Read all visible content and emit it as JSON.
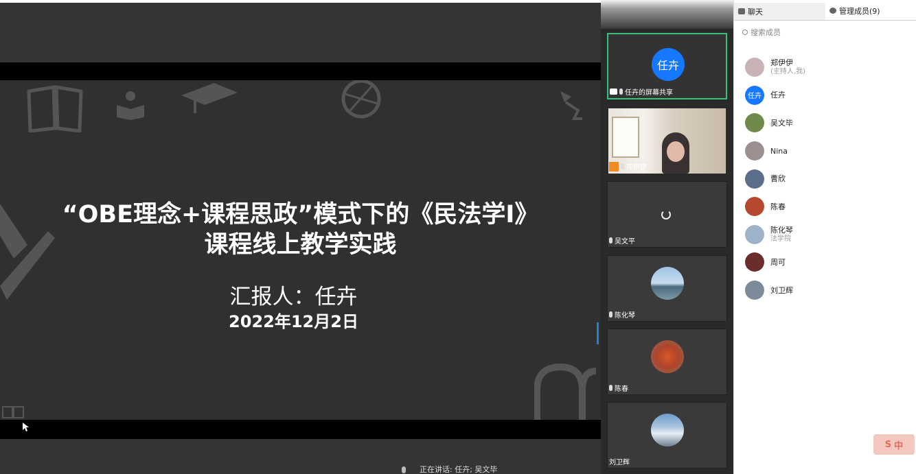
{
  "slide": {
    "title_line1": "“OBE理念+课程思政”模式下的《民法学I》",
    "title_line2": "课程线上教学实践",
    "presenter": "汇报人：任卉",
    "date": "2022年12月2日"
  },
  "status": {
    "speaking": "正在讲话: 任卉; 吴文毕"
  },
  "video_tiles": [
    {
      "name": "任卉的屏幕共享",
      "avatar_text": "任卉",
      "state": "screen-share"
    },
    {
      "name": "郑伊伊",
      "state": "camera"
    },
    {
      "name": "吴文平",
      "state": "loading"
    },
    {
      "name": "陈化琴",
      "state": "avatar"
    },
    {
      "name": "陈春",
      "state": "avatar"
    },
    {
      "name": "刘卫辉",
      "state": "avatar"
    }
  ],
  "panel": {
    "tab_chat": "聊天",
    "tab_members": "管理成员(9)",
    "search_placeholder": "搜索成员",
    "members": [
      {
        "name": "郑伊伊",
        "sub": "(主持人,我)",
        "color": "#c9b3b7"
      },
      {
        "name": "任卉",
        "sub": "",
        "avatar_text": "任卉",
        "color": "#1677ff"
      },
      {
        "name": "吴文毕",
        "sub": "",
        "color": "#6f8a4a"
      },
      {
        "name": "Nina",
        "sub": "",
        "color": "#9c8f8f"
      },
      {
        "name": "曹欣",
        "sub": "",
        "color": "#5b6f8c"
      },
      {
        "name": "陈春",
        "sub": "",
        "color": "#b5482f"
      },
      {
        "name": "陈化琴",
        "sub": "法学院",
        "color": "#9fb3c8"
      },
      {
        "name": "周可",
        "sub": "",
        "color": "#6b2c2c"
      },
      {
        "name": "刘卫辉",
        "sub": "",
        "color": "#7d8a99"
      }
    ]
  },
  "ime": {
    "icon": "S",
    "label": "中"
  }
}
